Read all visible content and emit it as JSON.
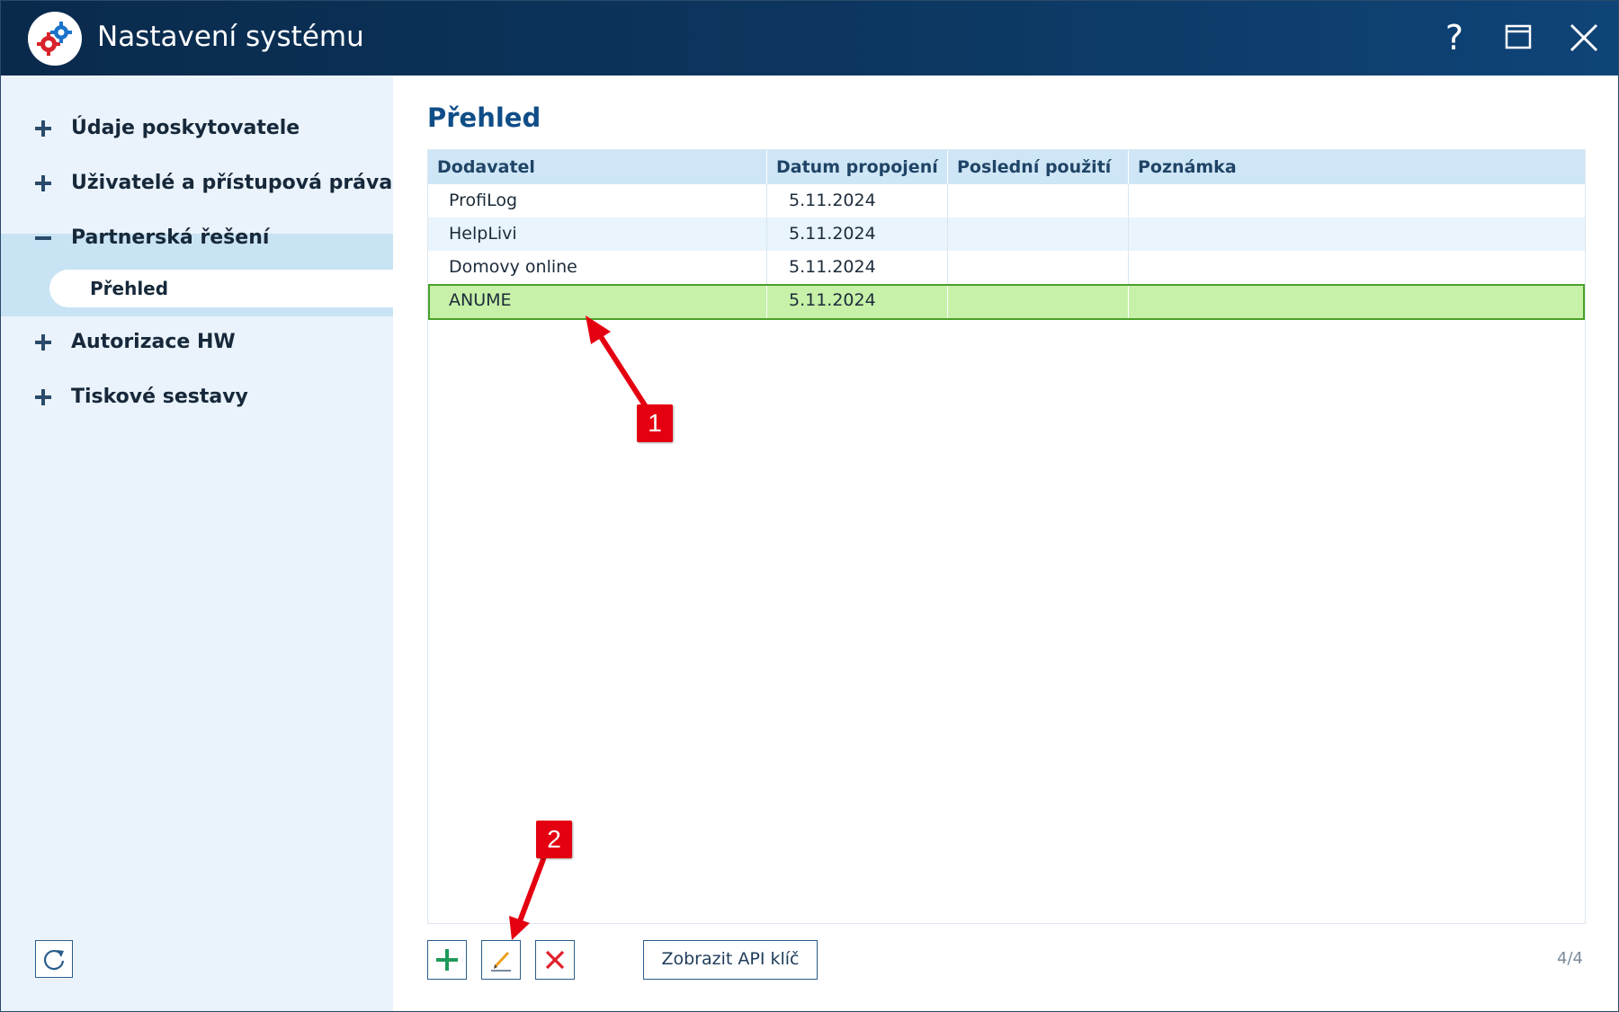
{
  "window": {
    "title": "Nastavení systému",
    "help_label": "?"
  },
  "sidebar": {
    "items": [
      {
        "label": "Údaje poskytovatele",
        "state": "collapsed"
      },
      {
        "label": "Uživatelé a přístupová práva",
        "state": "collapsed"
      },
      {
        "label": "Partnerská řešení",
        "state": "expanded"
      },
      {
        "label": "Autorizace HW",
        "state": "collapsed"
      },
      {
        "label": "Tiskové sestavy",
        "state": "collapsed"
      }
    ],
    "sub_item_active": "Přehled"
  },
  "main": {
    "title": "Přehled",
    "table": {
      "columns": [
        "Dodavatel",
        "Datum propojení",
        "Poslední použití",
        "Poznámka"
      ],
      "rows": [
        {
          "dodavatel": "ProfiLog",
          "datum": "5.11.2024",
          "posledni": "",
          "poznamka": ""
        },
        {
          "dodavatel": "HelpLivi",
          "datum": "5.11.2024",
          "posledni": "",
          "poznamka": ""
        },
        {
          "dodavatel": "Domovy online",
          "datum": "5.11.2024",
          "posledni": "",
          "poznamka": ""
        },
        {
          "dodavatel": "ANUME",
          "datum": "5.11.2024",
          "posledni": "",
          "poznamka": "",
          "selected": true
        }
      ]
    },
    "toolbar": {
      "api_key_label": "Zobrazit API klíč",
      "record_counter": "4/4"
    }
  },
  "annotations": {
    "badge_1": "1",
    "badge_2": "2",
    "color": "#e40010"
  },
  "colors": {
    "titlebar": "#0c3760",
    "accent": "#0f4d87",
    "selection": "#c7f0a8",
    "selection_border": "#4aa02a",
    "add": "#1f9a5a",
    "delete": "#e0202a"
  }
}
